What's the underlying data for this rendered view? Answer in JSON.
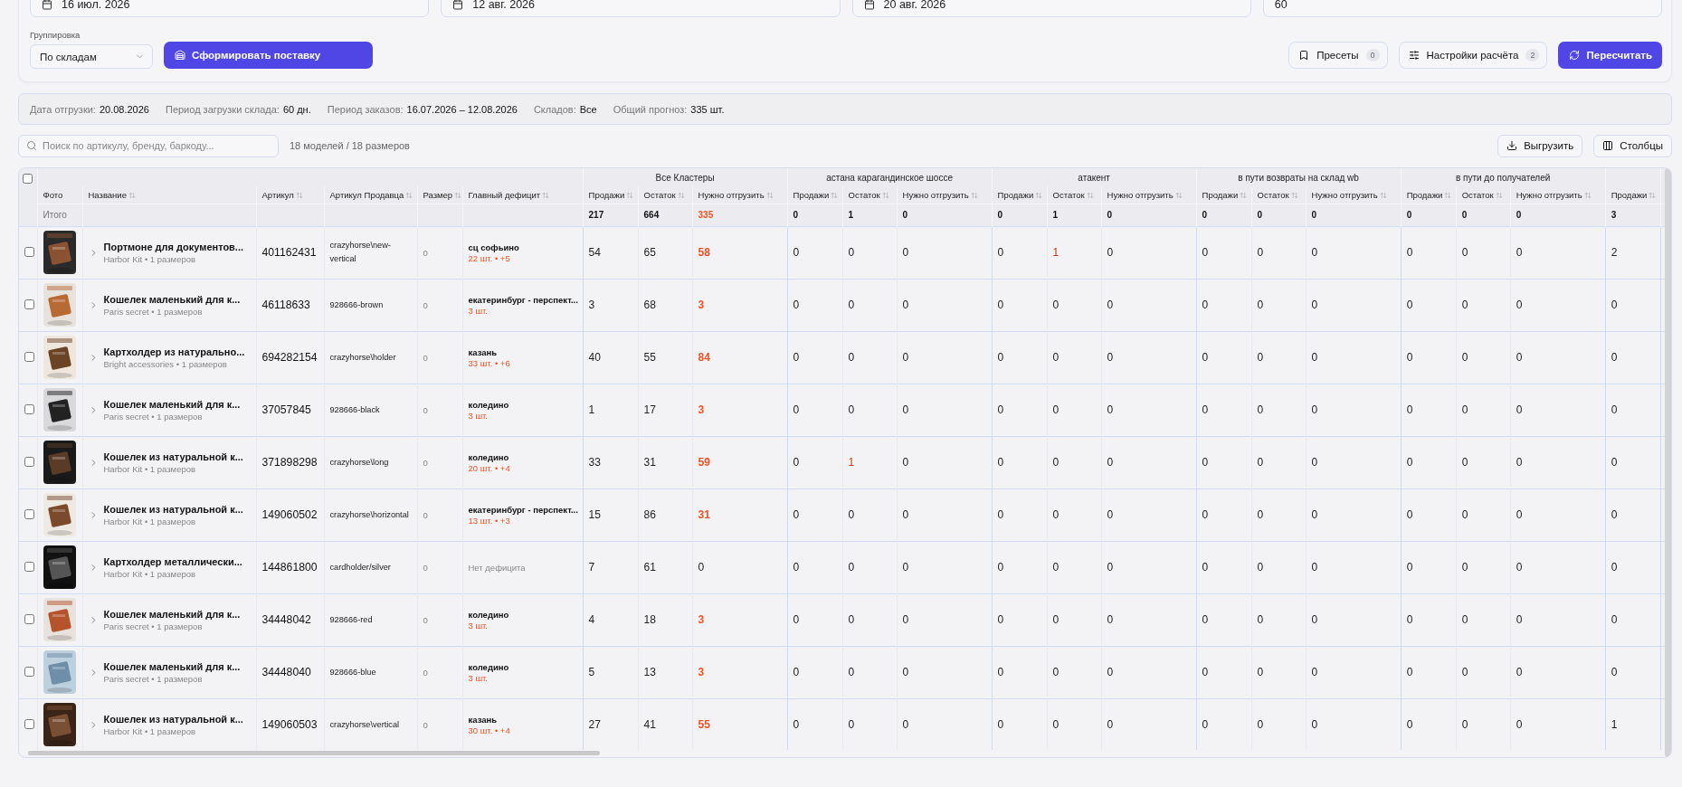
{
  "filters": {
    "fields": [
      {
        "kind": "date",
        "value": "16 июл. 2026"
      },
      {
        "kind": "date",
        "value": "12 авг. 2026"
      },
      {
        "kind": "date",
        "value": "20 авг. 2026"
      },
      {
        "kind": "number",
        "value": "60"
      }
    ],
    "grouping": {
      "label": "Группировка",
      "value": "По складам"
    },
    "create_button": "Сформировать поставку",
    "presets": {
      "label": "Пресеты",
      "count": "0"
    },
    "settings": {
      "label": "Настройки расчёта",
      "count": "2"
    },
    "recalc_button": "Пересчитать"
  },
  "summary": [
    {
      "label": "Дата отгрузки:",
      "value": "20.08.2026"
    },
    {
      "label": "Период загрузки склада:",
      "value": "60 дн."
    },
    {
      "label": "Период заказов:",
      "value": "16.07.2026 – 12.08.2026"
    },
    {
      "label": "Складов:",
      "value": "Все"
    },
    {
      "label": "Общий прогноз:",
      "value": "335 шт."
    }
  ],
  "toolbar": {
    "search_placeholder": "Поиск по артикулу, бренду, баркоду...",
    "count": "18 моделей / 18 размеров",
    "export_button": "Выгрузить",
    "columns_button": "Столбцы"
  },
  "table": {
    "select_all_checked": false,
    "columns": [
      {
        "label": "Фото",
        "sortable": false
      },
      {
        "label": "Название",
        "sortable": true
      },
      {
        "label": "Артикул",
        "sortable": true
      },
      {
        "label": "Артикул Продавца",
        "sortable": true
      },
      {
        "label": "Размер",
        "sortable": true
      },
      {
        "label": "Главный дефицит",
        "sortable": true
      }
    ],
    "groups": [
      {
        "title": "Все Кластеры",
        "columns": [
          "Продажи",
          "Остаток",
          "Нужно отгрузить"
        ]
      },
      {
        "title": "астана карагандинское шоссе",
        "columns": [
          "Продажи",
          "Остаток",
          "Нужно отгрузить"
        ]
      },
      {
        "title": "атакент",
        "columns": [
          "Продажи",
          "Остаток",
          "Нужно отгрузить"
        ]
      },
      {
        "title": "в пути возвраты на склад wb",
        "columns": [
          "Продажи",
          "Остаток",
          "Нужно отгрузить"
        ]
      },
      {
        "title": "в пути до получателей",
        "columns": [
          "Продажи",
          "Остаток",
          "Нужно отгрузить"
        ]
      },
      {
        "columns": [
          "Продажи"
        ]
      }
    ],
    "totals": {
      "label": "Итого",
      "values": [
        "217",
        "664",
        "335",
        "0",
        "1",
        "0",
        "0",
        "1",
        "0",
        "0",
        "0",
        "0",
        "0",
        "0",
        "0",
        "3"
      ]
    },
    "rows": [
      {
        "checked": false,
        "name": "Портмоне для документов...",
        "meta": "Harbor Kit • 1 размеров",
        "article": "401162431",
        "seller_article": "crazyhorse\\new-vertical",
        "size": "0",
        "deficit": {
          "kind": "deficit",
          "place": "сц софьино",
          "detail": "22 шт. • +5"
        },
        "values": [
          "54",
          "65",
          "58",
          "0",
          "0",
          "0",
          "0",
          {
            "value": "1",
            "alert": true
          },
          "0",
          "0",
          "0",
          "0",
          "0",
          "0",
          "0",
          "2"
        ]
      },
      {
        "checked": false,
        "name": "Кошелек маленький для к...",
        "meta": "Paris secret • 1 размеров",
        "article": "46118633",
        "seller_article": "928666-brown",
        "size": "0",
        "deficit": {
          "kind": "deficit",
          "place": "екатеринбург - перспект...",
          "detail": "3 шт."
        },
        "values": [
          "3",
          "68",
          "3",
          "0",
          "0",
          "0",
          "0",
          "0",
          "0",
          "0",
          "0",
          "0",
          "0",
          "0",
          "0",
          "0"
        ]
      },
      {
        "checked": false,
        "name": "Картхолдер из натурально...",
        "meta": "Bright accessories • 1 размеров",
        "article": "694282154",
        "seller_article": "crazyhorse\\holder",
        "size": "0",
        "deficit": {
          "kind": "deficit",
          "place": "казань",
          "detail": "33 шт. • +6"
        },
        "values": [
          "40",
          "55",
          "84",
          "0",
          "0",
          "0",
          "0",
          "0",
          "0",
          "0",
          "0",
          "0",
          "0",
          "0",
          "0",
          "0"
        ]
      },
      {
        "checked": false,
        "name": "Кошелек маленький для к...",
        "meta": "Paris secret • 1 размеров",
        "article": "37057845",
        "seller_article": "928666-black",
        "size": "0",
        "deficit": {
          "kind": "deficit",
          "place": "коледино",
          "detail": "3 шт."
        },
        "values": [
          "1",
          "17",
          "3",
          "0",
          "0",
          "0",
          "0",
          "0",
          "0",
          "0",
          "0",
          "0",
          "0",
          "0",
          "0",
          "0"
        ]
      },
      {
        "checked": false,
        "name": "Кошелек из натуральной к...",
        "meta": "Harbor Kit • 1 размеров",
        "article": "371898298",
        "seller_article": "crazyhorse\\long",
        "size": "0",
        "deficit": {
          "kind": "deficit",
          "place": "коледино",
          "detail": "20 шт. • +4"
        },
        "values": [
          "33",
          "31",
          "59",
          "0",
          {
            "value": "1",
            "alert": true
          },
          "0",
          "0",
          "0",
          "0",
          "0",
          "0",
          "0",
          "0",
          "0",
          "0",
          "0"
        ]
      },
      {
        "checked": false,
        "name": "Кошелек из натуральной к...",
        "meta": "Harbor Kit • 1 размеров",
        "article": "149060502",
        "seller_article": "crazyhorse\\horizontal",
        "size": "0",
        "deficit": {
          "kind": "deficit",
          "place": "екатеринбург - перспект...",
          "detail": "13 шт. • +3"
        },
        "values": [
          "15",
          "86",
          "31",
          "0",
          "0",
          "0",
          "0",
          "0",
          "0",
          "0",
          "0",
          "0",
          "0",
          "0",
          "0",
          "0"
        ]
      },
      {
        "checked": false,
        "name": "Картхолдер металлически...",
        "meta": "Harbor Kit • 1 размеров",
        "article": "144861800",
        "seller_article": "cardholder/silver",
        "size": "0",
        "deficit": {
          "kind": "none",
          "place": "Нет дефицита"
        },
        "values": [
          "7",
          "61",
          "0",
          "0",
          "0",
          "0",
          "0",
          "0",
          "0",
          "0",
          "0",
          "0",
          "0",
          "0",
          "0",
          "0"
        ]
      },
      {
        "checked": false,
        "name": "Кошелек маленький для к...",
        "meta": "Paris secret • 1 размеров",
        "article": "34448042",
        "seller_article": "928666-red",
        "size": "0",
        "deficit": {
          "kind": "deficit",
          "place": "коледино",
          "detail": "3 шт."
        },
        "values": [
          "4",
          "18",
          "3",
          "0",
          "0",
          "0",
          "0",
          "0",
          "0",
          "0",
          "0",
          "0",
          "0",
          "0",
          "0",
          "0"
        ]
      },
      {
        "checked": false,
        "name": "Кошелек маленький для к...",
        "meta": "Paris secret • 1 размеров",
        "article": "34448040",
        "seller_article": "928666-blue",
        "size": "0",
        "deficit": {
          "kind": "deficit",
          "place": "коледино",
          "detail": "3 шт."
        },
        "values": [
          "5",
          "13",
          "3",
          "0",
          "0",
          "0",
          "0",
          "0",
          "0",
          "0",
          "0",
          "0",
          "0",
          "0",
          "0",
          "0"
        ]
      },
      {
        "checked": false,
        "name": "Кошелек из натуральной к...",
        "meta": "Harbor Kit • 1 размеров",
        "article": "149060503",
        "seller_article": "crazyhorse\\vertical",
        "size": "0",
        "deficit": {
          "kind": "deficit",
          "place": "казань",
          "detail": "30 шт. • +4"
        },
        "values": [
          "27",
          "41",
          "55",
          "0",
          "0",
          "0",
          "0",
          "0",
          "0",
          "0",
          "0",
          "0",
          "0",
          "0",
          "0",
          "1"
        ]
      }
    ]
  }
}
